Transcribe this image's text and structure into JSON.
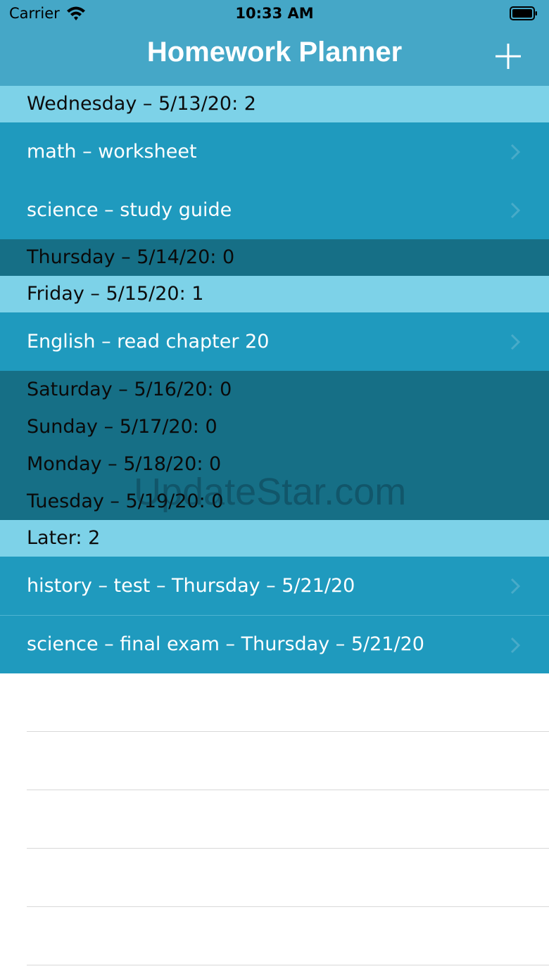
{
  "status_bar": {
    "carrier": "Carrier",
    "time": "10:33 AM",
    "icons": [
      "wifi-icon",
      "battery-icon"
    ]
  },
  "nav": {
    "title": "Homework Planner",
    "add_icon": "plus-icon"
  },
  "sections": [
    {
      "header": "Wednesday – 5/13/20: 2",
      "items": [
        "math – worksheet",
        "science – study guide"
      ]
    },
    {
      "header": "Thursday – 5/14/20: 0",
      "items": []
    },
    {
      "header": "Friday – 5/15/20: 1",
      "items": [
        "English – read chapter 20"
      ]
    },
    {
      "header": "Saturday – 5/16/20: 0",
      "items": []
    },
    {
      "header": "Sunday – 5/17/20: 0",
      "items": []
    },
    {
      "header": "Monday – 5/18/20: 0",
      "items": []
    },
    {
      "header": "Tuesday – 5/19/20: 0",
      "items": []
    },
    {
      "header": "Later: 2",
      "items": [
        "history – test – Thursday – 5/21/20",
        "science – final exam – Thursday – 5/21/20"
      ]
    }
  ],
  "watermark": "UpdateStar.com",
  "colors": {
    "nav_background": "#45a7c7",
    "header_with_items": "#7dd2e8",
    "header_empty": "#166f86",
    "row_background": "#1f9abe",
    "row_text": "#ffffff"
  }
}
